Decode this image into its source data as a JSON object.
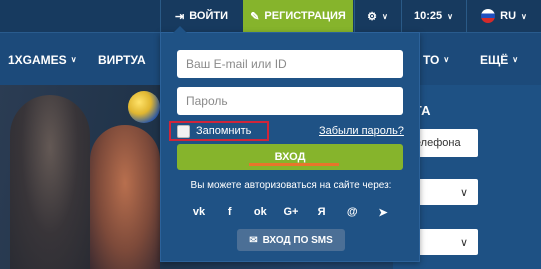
{
  "topbar": {
    "login_label": "ВОЙТИ",
    "register_label": "РЕГИСТРАЦИЯ",
    "time": "10:25",
    "lang": "RU"
  },
  "nav": {
    "items": [
      "1XGAMES",
      "ВИРТУА",
      "ЕЩЁ"
    ],
    "partial_right": "ТО"
  },
  "login_form": {
    "email_placeholder": "Ваш E-mail или ID",
    "password_placeholder": "Пароль",
    "remember_label": "Запомнить",
    "forgot_label": "Забыли пароль?",
    "enter_label": "ВХОД",
    "via_text": "Вы можете авторизоваться на сайте через:",
    "social_icons": [
      "vk",
      "f",
      "ok",
      "G+",
      "Я",
      "@",
      "telegram"
    ],
    "sms_label": "ВХОД ПО SMS"
  },
  "right_panel": {
    "title": "НТА",
    "field1": "телефона"
  },
  "colors": {
    "topbar_bg": "#173a5f",
    "accent_green": "#86b42c",
    "panel_bg": "#1f5285",
    "highlight_red": "#d0253a"
  }
}
